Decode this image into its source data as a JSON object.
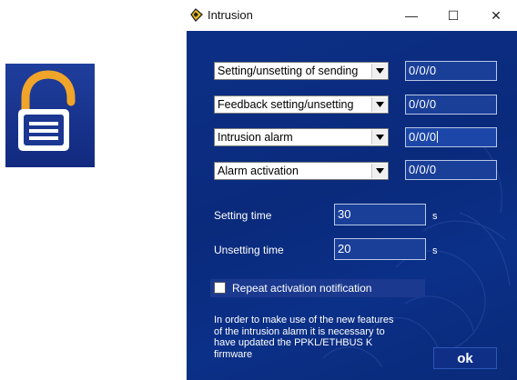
{
  "window": {
    "title": "Intrusion",
    "controls": {
      "minimize": "—",
      "maximize": "☐",
      "close": "✕"
    }
  },
  "rows": [
    {
      "select": "Setting/unsetting of sending",
      "address": "0/0/0"
    },
    {
      "select": "Feedback setting/unsetting",
      "address": "0/0/0"
    },
    {
      "select": "Intrusion alarm",
      "address": "0/0/0"
    },
    {
      "select": "Alarm activation",
      "address": "0/0/0"
    }
  ],
  "setting_time": {
    "label": "Setting time",
    "value": "30",
    "unit": "s"
  },
  "unsetting_time": {
    "label": "Unsetting time",
    "value": "20",
    "unit": "s"
  },
  "repeat_checkbox": {
    "label": "Repeat activation notification",
    "checked": false
  },
  "note": [
    "In order to make use of the new features",
    "of the intrusion alarm it is necessary to",
    "have updated the PPKL/ETHBUS K",
    "firmware"
  ],
  "ok_button": "ok",
  "colors": {
    "background": "#0a2a7c",
    "icon_tile": "#1a3590",
    "padlock_shackle": "#f0a52a",
    "input_field": "#1a3f99"
  },
  "icons": {
    "app_tile": "padlock-open-icon",
    "title": "padlock-icon"
  }
}
